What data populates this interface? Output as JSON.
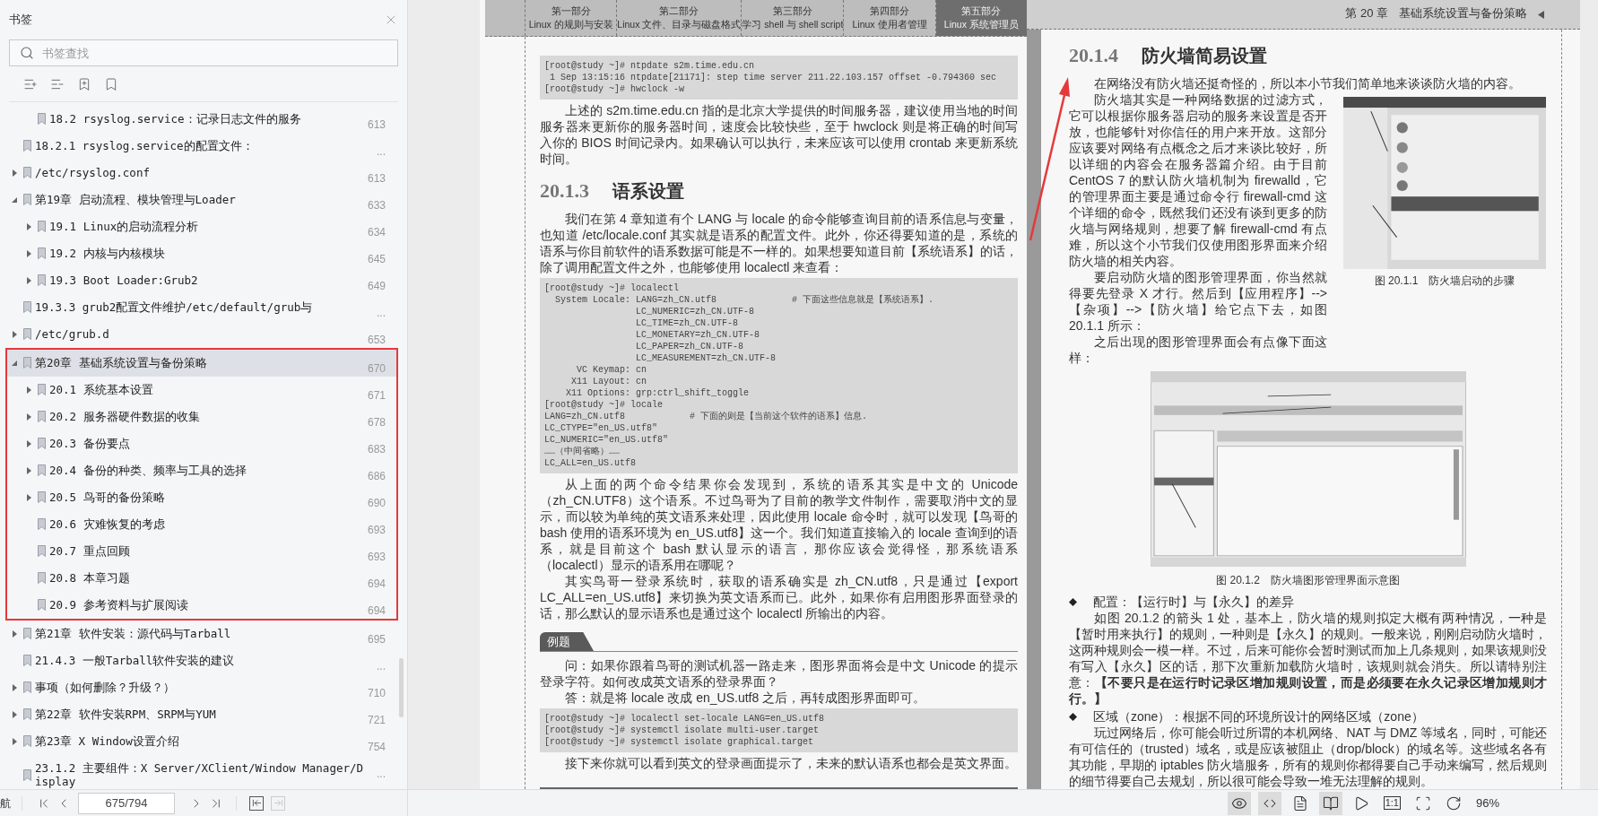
{
  "sidebar": {
    "title": "书签",
    "search": {
      "placeholder": "书签查找"
    },
    "bookmarks": [
      {
        "children": [
          {
            "label": "18.2 rsyslog.service：记录日志文件的服务",
            "page": "613",
            "selected": false
          }
        ]
      },
      {
        "label": "18.2.1 rsyslog.service的配置文件：",
        "page": "...",
        "selected": false
      },
      {
        "label": "/etc/rsyslog.conf",
        "page": "613",
        "expanded": false,
        "selected": false
      },
      {
        "label": "第19章 启动流程、模块管理与Loader",
        "page": "633",
        "expanded": true,
        "selected": false,
        "children": [
          {
            "label": "19.1 Linux的启动流程分析",
            "page": "634",
            "expanded": false,
            "selected": false
          },
          {
            "label": "19.2 内核与内核模块",
            "page": "645",
            "expanded": false,
            "selected": false
          },
          {
            "label": "19.3 Boot Loader:Grub2",
            "page": "649",
            "expanded": false,
            "selected": false
          }
        ]
      },
      {
        "label": "19.3.3 grub2配置文件维护/etc/default/grub与",
        "page": "...",
        "selected": false
      },
      {
        "label": "/etc/grub.d",
        "page": "653",
        "expanded": false,
        "selected": false
      },
      {
        "label": "第20章 基础系统设置与备份策略",
        "page": "670",
        "expanded": true,
        "selected": true,
        "annotated": true,
        "children": [
          {
            "label": "20.1 系统基本设置",
            "page": "671",
            "expanded": false,
            "selected": false
          },
          {
            "label": "20.2 服务器硬件数据的收集",
            "page": "678",
            "expanded": false,
            "selected": false
          },
          {
            "label": "20.3 备份要点",
            "page": "683",
            "expanded": false,
            "selected": false
          },
          {
            "label": "20.4 备份的种类、频率与工具的选择",
            "page": "686",
            "expanded": false,
            "selected": false
          },
          {
            "label": "20.5 鸟哥的备份策略",
            "page": "690",
            "expanded": false,
            "selected": false
          },
          {
            "label": "20.6 灾难恢复的考虑",
            "page": "693",
            "selected": false
          },
          {
            "label": "20.7 重点回顾",
            "page": "693",
            "selected": false
          },
          {
            "label": "20.8 本章习题",
            "page": "694",
            "selected": false
          },
          {
            "label": "20.9 参考资料与扩展阅读",
            "page": "694",
            "selected": false
          }
        ]
      },
      {
        "label": "第21章 软件安装：源代码与Tarball",
        "page": "695",
        "expanded": false,
        "selected": false
      },
      {
        "label": "21.4.3 一般Tarball软件安装的建议",
        "page": "...",
        "selected": false
      },
      {
        "label": "事项（如何删除？升级？）",
        "page": "710",
        "expanded": false,
        "selected": false
      },
      {
        "label": "第22章 软件安装RPM、SRPM与YUM",
        "page": "721",
        "expanded": false,
        "selected": false
      },
      {
        "label": "第23章 X Window设置介绍",
        "page": "754",
        "expanded": false,
        "selected": false
      },
      {
        "label": "23.1.2 主要组件：X Server/XClient/Window Manager/Display",
        "page": "...",
        "selected": false
      }
    ],
    "nav": {
      "label": "航",
      "page_field": {
        "value": "675/794"
      },
      "history": [
        {
          "kind": "back",
          "disabled": false
        },
        {
          "kind": "forward",
          "disabled": true
        }
      ]
    }
  },
  "left_page": {
    "tabs": [
      {
        "part": "第一部分",
        "title": "Linux 的规则与安装",
        "selected": false
      },
      {
        "part": "第二部分",
        "title": "Linux 文件、目录与磁盘格式",
        "selected": false
      },
      {
        "part": "第三部分",
        "title": "学习 shell 与 shell script",
        "selected": false
      },
      {
        "part": "第四部分",
        "title": "Linux 使用者管理",
        "selected": false
      },
      {
        "part": "第五部分",
        "title": "Linux 系统管理员",
        "selected": true
      }
    ],
    "blocks": [
      {
        "kind": "code",
        "lines": [
          "[root@study ~]# ntpdate s2m.time.edu.cn",
          " 1 Sep 13:15:16 ntpdate[21171]: step time server 211.22.103.157 offset -0.794360 sec",
          "[root@study ~]# hwclock -w"
        ]
      },
      {
        "kind": "para",
        "text": "上述的 s2m.time.edu.cn 指的是北京大学提供的时间服务器，建议使用当地的时间服务器来更新你的服务器时间，速度会比较快些，至于 hwclock 则是将正确的时间写入你的 BIOS 时间记录内。如果确认可以执行，未来应该可以使用 crontab 来更新系统时间。"
      },
      {
        "kind": "heading",
        "number": "20.1.3",
        "title": "语系设置"
      },
      {
        "kind": "para",
        "text": "我们在第 4 章知道有个 LANG 与 locale 的命令能够查询目前的语系信息与变量，也知道 /etc/locale.conf 其实就是语系的配置文件。此外，你还得要知道的是，系统的语系与你目前软件的语系数据可能是不一样的。如果想要知道目前【系统语系】的话，除了调用配置文件之外，也能够使用 localectl 来查看："
      },
      {
        "kind": "code",
        "lines": [
          "[root@study ~]# localectl",
          "  System Locale: LANG=zh_CN.utf8              # 下面这些信息就是【系统语系】.",
          "                 LC_NUMERIC=zh_CN.UTF-8",
          "                 LC_TIME=zh_CN.UTF-8",
          "                 LC_MONETARY=zh_CN.UTF-8",
          "                 LC_PAPER=zh_CN.UTF-8",
          "                 LC_MEASUREMENT=zh_CN.UTF-8",
          "      VC Keymap: cn",
          "     X11 Layout: cn",
          "    X11 Options: grp:ctrl_shift_toggle",
          "[root@study ~]# locale",
          "LANG=zh_CN.utf8            # 下面的则是【当前这个软件的语系】信息.",
          "LC_CTYPE=\"en_US.utf8\"",
          "LC_NUMERIC=\"en_US.utf8\"",
          "……（中间省略）……",
          "LC_ALL=en_US.utf8"
        ]
      },
      {
        "kind": "para",
        "text": "从上面的两个命令结果你会发现到，系统的语系其实是中文的 Unicode（zh_CN.UTF8）这个语系。不过鸟哥为了目前的教学文件制作，需要取消中文的显示，而以较为单纯的英文语系来处理，因此使用 locale 命令时，就可以发现【鸟哥的 bash 使用的语系环境为 en_US.utf8】这一个。我们知道直接输入的 locale 查询到的语系，就是目前这个 bash 默认显示的语言，那你应该会觉得怪，那系统语系（localectl）显示的语系用在哪呢？"
      },
      {
        "kind": "para",
        "text": "其实鸟哥一登录系统时，获取的语系确实是 zh_CN.utf8，只是通过【export LC_ALL=en_US.utf8】来切换为英文语系而已。此外，如果你有启用图形界面登录的话，那么默认的显示语系也是通过这个 localectl 所输出的内容。"
      },
      {
        "kind": "example",
        "label": "例题"
      },
      {
        "kind": "para",
        "text": "问：如果你跟着鸟哥的测试机器一路走来，图形界面将会是中文 Unicode 的提示登录字符。如何改成英文语系的登录界面？"
      },
      {
        "kind": "para",
        "text": "答：就是将 locale 改成 en_US.utf8 之后，再转成图形界面即可。"
      },
      {
        "kind": "code",
        "lines": [
          "[root@study ~]# localectl set-locale LANG=en_US.utf8",
          "[root@study ~]# systemctl isolate multi-user.target",
          "[root@study ~]# systemctl isolate graphical.target"
        ]
      },
      {
        "kind": "para",
        "text": "接下来你就可以看到英文的登录画面提示了，未来的默认语系也都会是英文界面。"
      }
    ]
  },
  "right_page": {
    "chapter_number": "第 20 章",
    "chapter_title": "基础系统设置与备份策略",
    "arrow_annotation": true,
    "blocks": [
      {
        "kind": "heading",
        "number": "20.1.4",
        "title": "防火墙简易设置"
      },
      {
        "kind": "para",
        "text": "在网络没有防火墙还挺奇怪的，所以本小节我们简单地来谈谈防火墙的内容。"
      },
      {
        "kind": "float",
        "paras": [
          "防火墙其实是一种网络数据的过滤方式，它可以根据你服务器启动的服务来设置是否开放，也能够针对你信任的用户来开放。这部分应该要对网络有点概念之后才来谈比较好，所以详细的内容会在服务器篇介绍。由于目前 CentOS 7 的默认防火墙机制为 firewalld，它的管理界面主要是通过命令行 firewall-cmd 这个详细的命令，既然我们还没有谈到更多的防火墙与网络规则，想要了解 firewall-cmd 有点难，所以这个小节我们仅使用图形界面来介绍防火墙的相关内容。",
          "要启动防火墙的图形管理界面，你当然就得要先登录 X 才行。然后到【应用程序】-->【杂项】-->【防火墙】给它点下去，如图 20.1.1 所示：",
          "之后出现的图形管理界面会有点像下面这样："
        ],
        "caption": "图 20.1.1　防火墙启动的步骤"
      },
      {
        "kind": "figure",
        "caption": "图 20.1.2　防火墙图形管理界面示意图"
      },
      {
        "kind": "bullet",
        "text": "配置：【运行时】与【永久】的差异"
      },
      {
        "kind": "para",
        "text": "如图 20.1.2 的箭头 1 处，基本上，防火墙的规则拟定大概有两种情况，一种是【暂时用来执行】的规则，一种则是【永久】的规则。一般来说，刚刚启动防火墙时，这两种规则会一模一样。不过，后来可能你会暂时测试而加上几条规则，如果该规则没有写入【永久】区的话，那下次重新加载防火墙时，该规则就会消失。所以请特别注意：**【不要只是在运行时记录区增加规则设置，而是必须要在永久记录区增加规则才行。】**"
      },
      {
        "kind": "bullet",
        "text": "区域（zone）：根据不同的环境所设计的网络区域（zone）"
      },
      {
        "kind": "para",
        "text": "玩过网络后，你可能会听过所谓的本机网络、NAT 与 DMZ 等域名，同时，可能还有可信任的（trusted）域名，或是应该被阻止（drop/block）的域名等。这些域名各有其功能，早期的 iptables 防火墙服务，所有的规则你都得要自己手动来编写，然后规则的细节得要自己去规划，所以很可能会导致一堆无法理解的规则。"
      }
    ]
  },
  "toolbar": {
    "buttons": [
      {
        "kind": "eye",
        "selected": true
      },
      {
        "kind": "fit-width",
        "selected": true
      },
      {
        "kind": "single-page",
        "selected": false
      },
      {
        "kind": "two-page",
        "selected": true
      },
      {
        "kind": "play",
        "selected": false
      },
      {
        "kind": "actual-size",
        "label": "1:1",
        "selected": false
      },
      {
        "kind": "fit-page",
        "selected": false
      },
      {
        "kind": "rotate",
        "selected": false
      }
    ],
    "zoom": "96%"
  }
}
